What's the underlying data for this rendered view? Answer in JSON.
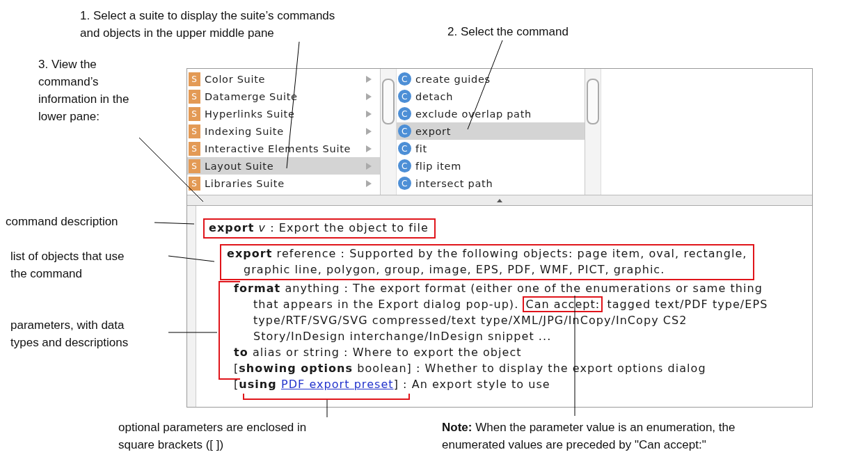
{
  "callouts": [
    {
      "kind": "top",
      "lines": [
        "1. Select a suite to display the suite’s commands",
        "and objects in the upper middle pane"
      ]
    },
    {
      "kind": "top2",
      "lines": [
        "2. Select the command"
      ]
    },
    {
      "kind": "view",
      "lines": [
        "3. View the",
        "command’s",
        "information in the",
        "lower pane:"
      ]
    },
    {
      "kind": "desc",
      "lines": [
        "command description"
      ]
    },
    {
      "kind": "objects",
      "lines": [
        "list of objects that use",
        "the command"
      ]
    },
    {
      "kind": "params",
      "lines": [
        "parameters, with data",
        "types and descriptions"
      ]
    },
    {
      "kind": "optional",
      "lines": [
        "optional parameters are enclosed in",
        "square brackets ([ ])"
      ]
    },
    {
      "kind": "note",
      "lines": [
        "**Note:** When the parameter value is an enumeration, the",
        "enumerated values are preceded by \"Can accept:\""
      ]
    }
  ],
  "suites": [
    {
      "name": "Color Suite",
      "icon_letter": "S",
      "selected": false
    },
    {
      "name": "Datamerge Suite",
      "icon_letter": "S",
      "selected": false
    },
    {
      "name": "Hyperlinks Suite",
      "icon_letter": "S",
      "selected": false
    },
    {
      "name": "Indexing Suite",
      "icon_letter": "S",
      "selected": false
    },
    {
      "name": "Interactive Elements Suite",
      "icon_letter": "S",
      "selected": false
    },
    {
      "name": "Layout Suite",
      "icon_letter": "S",
      "selected": true
    },
    {
      "name": "Libraries Suite",
      "icon_letter": "S",
      "selected": false
    }
  ],
  "commands": [
    {
      "name": "create guides",
      "icon_letter": "C",
      "selected": false
    },
    {
      "name": "detach",
      "icon_letter": "C",
      "selected": false
    },
    {
      "name": "exclude overlap path",
      "icon_letter": "C",
      "selected": false
    },
    {
      "name": "export",
      "icon_letter": "C",
      "selected": true
    },
    {
      "name": "fit",
      "icon_letter": "C",
      "selected": false
    },
    {
      "name": "flip item",
      "icon_letter": "C",
      "selected": false
    },
    {
      "name": "intersect path",
      "icon_letter": "C",
      "selected": false
    }
  ],
  "description": {
    "command_line": "**export** *v* : Export the object to file",
    "direct_parameter": [
      "**export** reference : Supported by the following objects: page item, oval, rectangle,",
      "graphic line, polygon, group, image, EPS, PDF, WMF, PICT, graphic."
    ],
    "parameters": [
      {
        "kind": "plain",
        "text": "**format** anything : The export format (either one of the enumerations or same thing"
      },
      {
        "kind": "accept",
        "before": "that appears in the Export dialog pop-up).",
        "highlight": "Can accept:",
        "after": "tagged text/PDF type/EPS"
      },
      {
        "kind": "cont",
        "text": "type/RTF/SVG/SVG compressed/text type/XML/JPG/InCopy/InCopy CS2"
      },
      {
        "kind": "cont",
        "text": "Story/InDesign interchange/InDesign snippet ..."
      },
      {
        "kind": "plain",
        "text": "**to** alias or string : Where to export the object"
      },
      {
        "kind": "plain",
        "text": "[**showing options** boolean] : Whether to display the export options dialog"
      },
      {
        "kind": "link",
        "before": "[**using**",
        "link": "PDF export preset",
        "after": "] : An export style to use"
      }
    ]
  }
}
